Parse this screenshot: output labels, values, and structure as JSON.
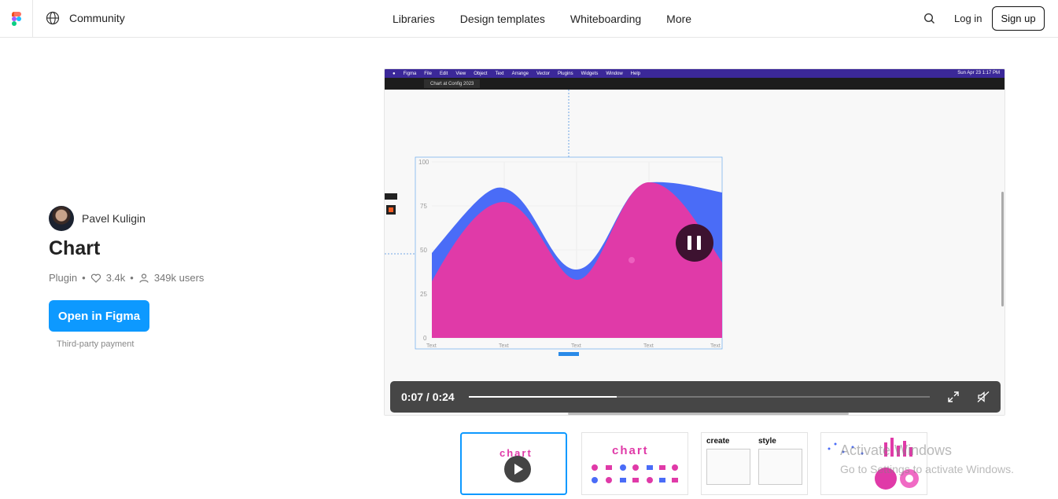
{
  "header": {
    "community_label": "Community",
    "nav": [
      "Libraries",
      "Design templates",
      "Whiteboarding",
      "More"
    ],
    "login_label": "Log in",
    "signup_label": "Sign up"
  },
  "plugin": {
    "author": "Pavel Kuligin",
    "title": "Chart",
    "type": "Plugin",
    "likes": "3.4k",
    "users": "349k users",
    "open_label": "Open in Figma",
    "payment_note": "Third-party payment"
  },
  "video": {
    "menubar": [
      "Figma",
      "File",
      "Edit",
      "View",
      "Object",
      "Text",
      "Arrange",
      "Vector",
      "Plugins",
      "Widgets",
      "Window",
      "Help"
    ],
    "menubar_right": "Sun Apr 23  1:17 PM",
    "tab_label": "Chart at Config 2023",
    "time": "0:07 / 0:24",
    "progress": 0.32,
    "chart": {
      "y_ticks": [
        "100",
        "75",
        "50",
        "25",
        "0"
      ],
      "x_ticks": [
        "Text",
        "Text",
        "Text",
        "Text",
        "Text"
      ],
      "colors": {
        "series_back": "#4a6cf7",
        "series_front": "#e03aa8"
      }
    }
  },
  "thumbnails": [
    {
      "label": "chart",
      "active": true
    },
    {
      "label": "chart",
      "active": false
    },
    {
      "label_left": "create",
      "label_right": "style",
      "active": false
    },
    {
      "label": "",
      "active": false
    }
  ],
  "watermark": {
    "line1": "Activate Windows",
    "line2": "Go to Settings to activate Windows."
  }
}
